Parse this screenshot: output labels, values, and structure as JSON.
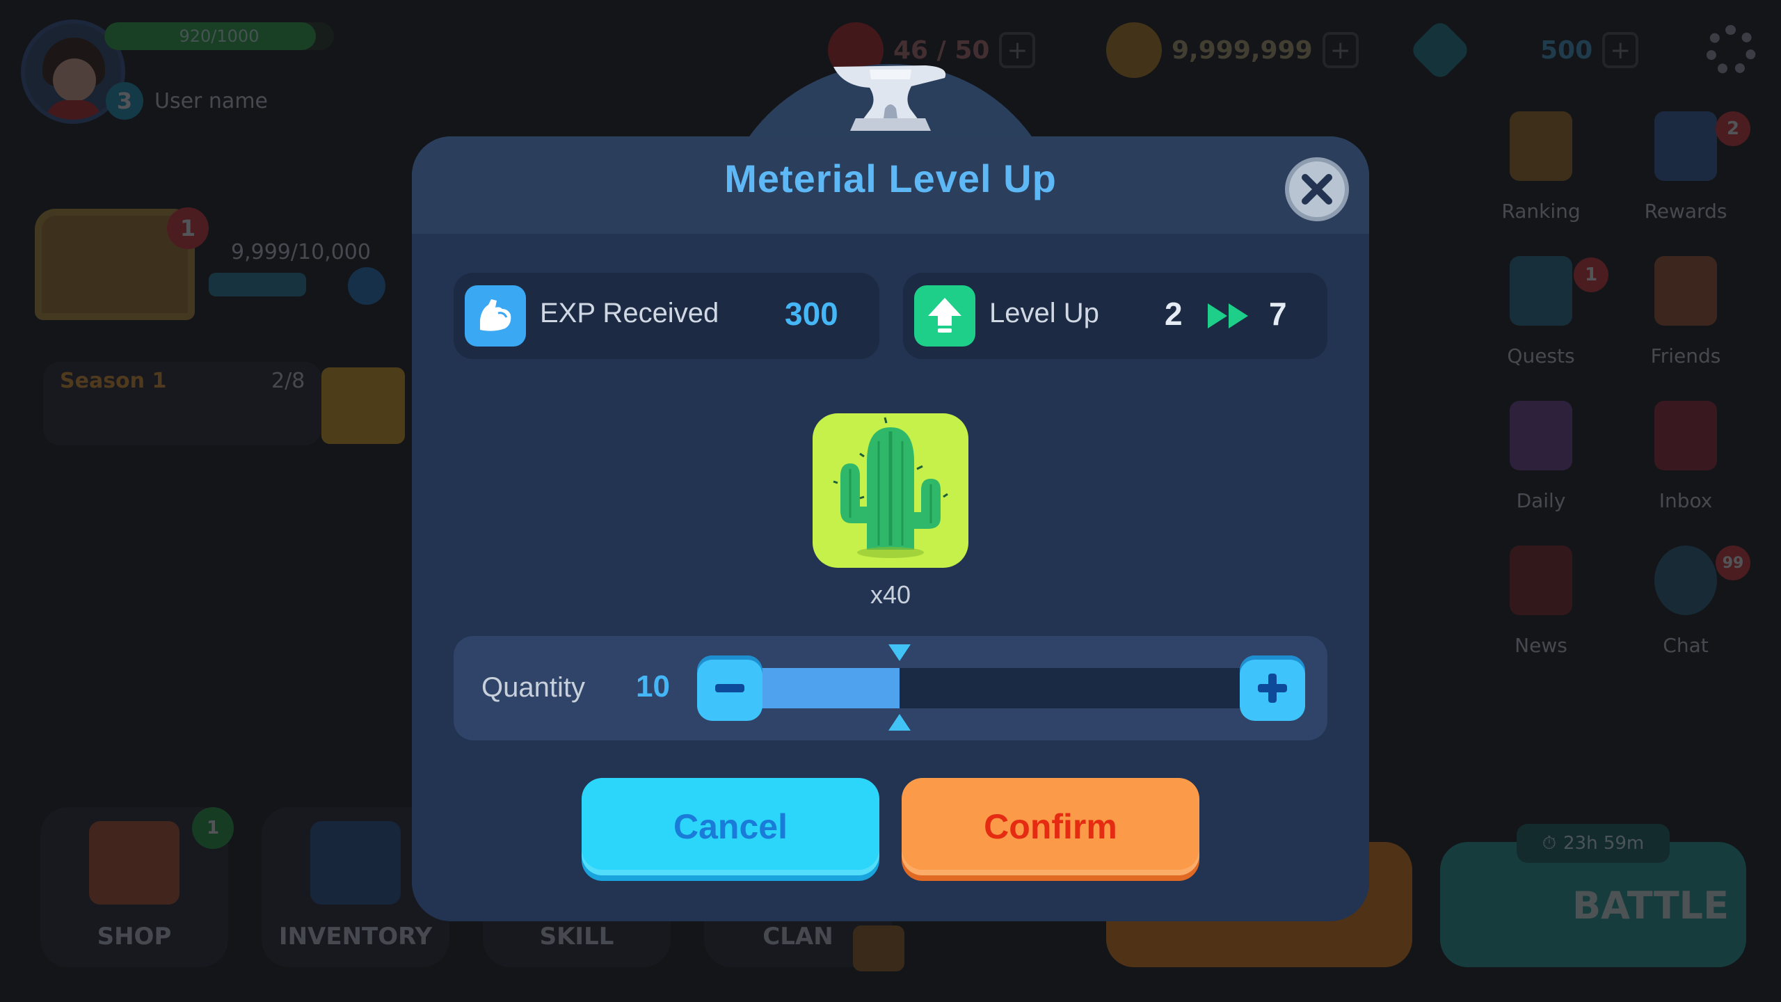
{
  "hud": {
    "xp_text": "920/1000",
    "xp_fraction": 0.92,
    "player_level": "3",
    "user_name": "User name",
    "hearts": "46 / 50",
    "coins": "9,999,999",
    "gems": "500",
    "chest_progress": "9,999/10,000",
    "chest_badge": "1",
    "season_title": "Season 1",
    "season_progress": "2/8",
    "season_level": "1"
  },
  "side_menu": [
    {
      "label": "Ranking",
      "badge": ""
    },
    {
      "label": "Rewards",
      "badge": "2"
    },
    {
      "label": "Quests",
      "badge": "1"
    },
    {
      "label": "Friends",
      "badge": ""
    },
    {
      "label": "Daily",
      "badge": ""
    },
    {
      "label": "Inbox",
      "badge": ""
    },
    {
      "label": "News",
      "badge": ""
    },
    {
      "label": "Chat",
      "badge": "99"
    }
  ],
  "bottom_nav": [
    {
      "label": "SHOP",
      "badge": "1"
    },
    {
      "label": "INVENTORY",
      "badge": ""
    },
    {
      "label": "SKILL",
      "badge": ""
    },
    {
      "label": "CLAN",
      "badge": ""
    }
  ],
  "battle": {
    "label": "BATTLE",
    "timer": "23h 59m"
  },
  "modal": {
    "title": "Meterial Level Up",
    "exp_label": "EXP Received",
    "exp_value": "300",
    "levelup_label": "Level Up",
    "level_from": "2",
    "level_to": "7",
    "item_count": "x40",
    "quantity_label": "Quantity",
    "quantity_value": "10",
    "quantity_fraction": 0.25,
    "cancel_label": "Cancel",
    "confirm_label": "Confirm"
  },
  "colors": {
    "title": "#5eb8f6",
    "exp_value": "#45b6f6",
    "level_values": "#e6ecf4",
    "item_bg": "#c6f04a",
    "cancel": "#2cd6fb",
    "confirm": "#fb9a48"
  },
  "icons": {
    "exp": "flexed-arm-icon",
    "levelup": "up-arrow-icon",
    "item": "cactus-icon",
    "close": "close-icon",
    "header": "anvil-icon"
  }
}
